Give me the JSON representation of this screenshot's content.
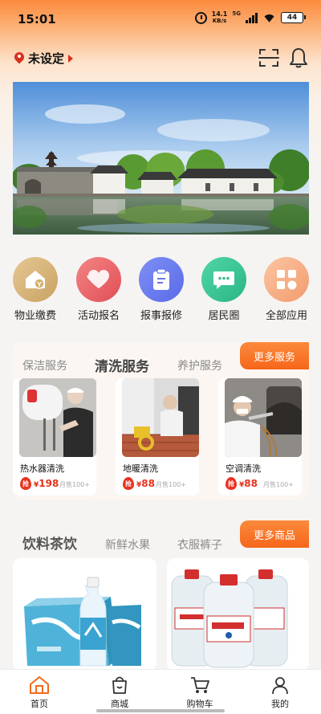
{
  "status_bar": {
    "time": "15:01",
    "net_speed": "14.1",
    "net_speed_unit": "KB/s",
    "network": "5G",
    "battery": "44"
  },
  "header": {
    "location": "未设定"
  },
  "quick_apps": [
    {
      "label": "物业缴费",
      "icon": "property-fee-icon",
      "color": "#d8b57a"
    },
    {
      "label": "活动报名",
      "icon": "activity-signup-icon",
      "color": "#ee6a6a"
    },
    {
      "label": "报事报修",
      "icon": "repair-report-icon",
      "color": "#6a7ef0"
    },
    {
      "label": "居民圈",
      "icon": "resident-circle-icon",
      "color": "#3cc596"
    },
    {
      "label": "全部应用",
      "icon": "all-apps-icon",
      "color": "#f6a37a"
    }
  ],
  "services": {
    "tabs": [
      "保洁服务",
      "清洗服务",
      "养护服务"
    ],
    "active_tab": "清洗服务",
    "more_label": "更多服务",
    "items": [
      {
        "name": "热水器清洗",
        "badge": "抢",
        "currency": "¥",
        "price": "198",
        "sold": "月售100+"
      },
      {
        "name": "地暖清洗",
        "badge": "抢",
        "currency": "¥",
        "price": "88",
        "sold": "月售100+"
      },
      {
        "name": "空调清洗",
        "badge": "抢",
        "currency": "¥",
        "price": "88",
        "sold": "月售100+"
      }
    ]
  },
  "goods": {
    "tabs": [
      "饮料茶饮",
      "新鲜水果",
      "衣服裤子"
    ],
    "active_tab": "饮料茶饮",
    "more_label": "更多商品"
  },
  "tabbar": [
    {
      "label": "首页",
      "icon": "home-icon",
      "active": true
    },
    {
      "label": "商城",
      "icon": "shopping-bag-icon",
      "active": false
    },
    {
      "label": "购物车",
      "icon": "cart-icon",
      "active": false
    },
    {
      "label": "我的",
      "icon": "profile-icon",
      "active": false
    }
  ],
  "colors": {
    "accent": "#f6661b",
    "price": "#e8321e"
  }
}
